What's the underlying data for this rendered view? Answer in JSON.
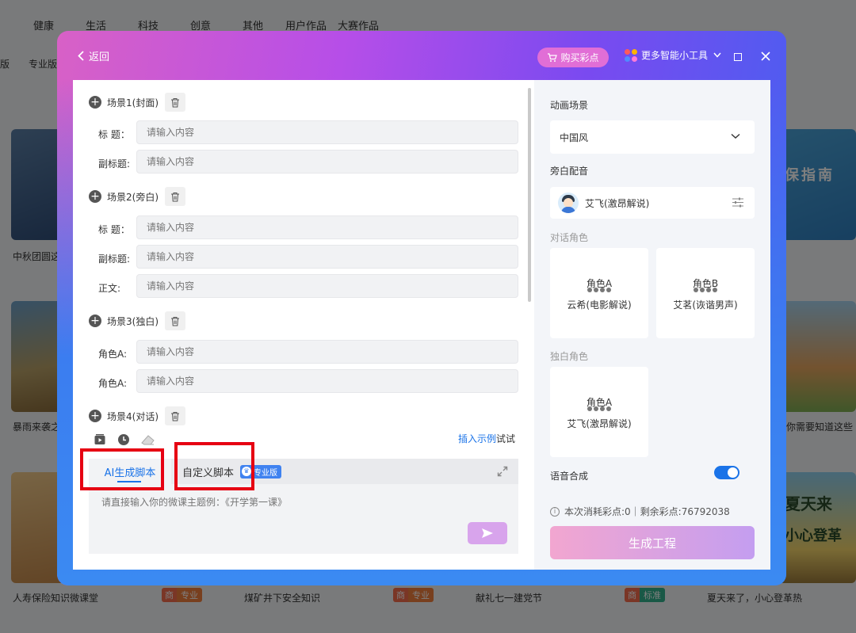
{
  "background": {
    "nav": [
      "健康",
      "生活",
      "科技",
      "创意",
      "其他",
      "用户作品",
      "大赛作品"
    ],
    "subnav": [
      "版",
      "专业版"
    ],
    "card_titles": [
      "中秋团圆这",
      "暴雨来袭之",
      "人寿保险知识微课堂",
      "煤矿井下安全知识",
      "献礼七一建党节",
      "夏天来了，小心登革热",
      "你需要知道这些"
    ],
    "badges": [
      {
        "left": "商",
        "right": "专业",
        "color": "#f07f3c"
      },
      {
        "left": "商",
        "right": "专业",
        "color": "#f07f3c"
      },
      {
        "left": "商",
        "right": "标准",
        "color": "#33b08d"
      }
    ],
    "card_texts": [
      "保指南",
      "夏天来",
      "小心登革"
    ]
  },
  "header": {
    "back_label": "返回",
    "buy_label": "购买彩点",
    "tools_label": "更多智能小工具"
  },
  "scenes": [
    {
      "title": "场景1(封面)",
      "fields": [
        {
          "label": "标  题：",
          "placeholder": "请输入内容"
        },
        {
          "label": "副标题:",
          "placeholder": "请输入内容"
        }
      ]
    },
    {
      "title": "场景2(旁白)",
      "fields": [
        {
          "label": "标  题：",
          "placeholder": "请输入内容"
        },
        {
          "label": "副标题:",
          "placeholder": "请输入内容"
        },
        {
          "label": "正文:",
          "placeholder": "请输入内容"
        }
      ]
    },
    {
      "title": "场景3(独白)",
      "fields": [
        {
          "label": "角色A:",
          "placeholder": "请输入内容"
        },
        {
          "label": "角色A:",
          "placeholder": "请输入内容"
        }
      ]
    },
    {
      "title": "场景4(对话)",
      "fields": []
    }
  ],
  "script": {
    "insert_link": "插入示例",
    "insert_suffix": "试试",
    "tab_ai": "AI生成脚本",
    "tab_custom": "自定义脚本",
    "pro_tag": "专业版",
    "placeholder": "请直接输入你的微课主题例：《开学第一课》"
  },
  "settings": {
    "scene_label": "动画场景",
    "scene_value": "中国风",
    "narration_label": "旁白配音",
    "narration_voice": "艾飞(激昂解说)",
    "dialogue_label": "对话角色",
    "dialogue_roles": [
      {
        "name": "角色A",
        "voice": "云希(电影解说)"
      },
      {
        "name": "角色B",
        "voice": "艾茗(诙谐男声)"
      }
    ],
    "monologue_label": "独白角色",
    "monologue_role": {
      "name": "角色A",
      "voice": "艾飞(激昂解说)"
    },
    "tts_label": "语音合成",
    "tts_enabled": true,
    "cost_text": "本次消耗彩点:0｜剩余彩点:76792038",
    "generate_label": "生成工程"
  },
  "colors": {
    "accent": "#1a73e8",
    "highlight_box": "#e60012"
  }
}
